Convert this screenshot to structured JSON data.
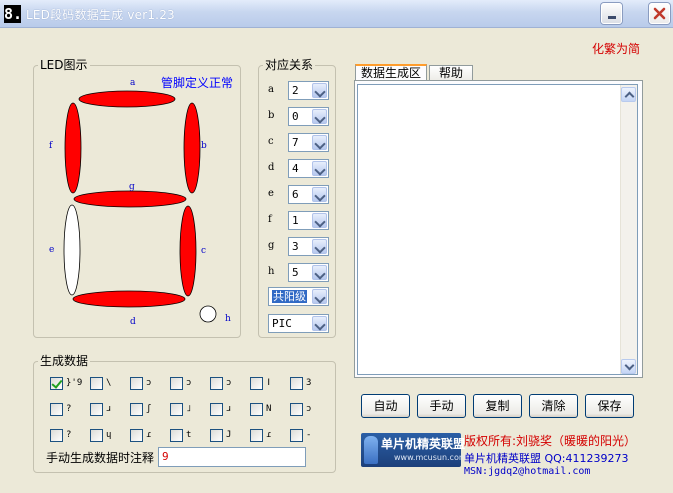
{
  "window": {
    "icon_glyph": "8.",
    "title": "LED段码数据生成 ver1.23",
    "minimize_icon": "minimize-icon",
    "close_icon": "close-icon"
  },
  "top_link": "化繁为简",
  "led_group": {
    "title": "LED图示",
    "pin_definition": "管脚定义正常",
    "segment_letters": [
      "a",
      "b",
      "c",
      "d",
      "e",
      "f",
      "g",
      "h"
    ],
    "segments_lit": [
      "a",
      "b",
      "c",
      "d",
      "f",
      "g"
    ],
    "segments_unlit": [
      "e",
      "h"
    ],
    "lit_color": "#ff0000",
    "unlit_color": "#ffffff"
  },
  "mapping_group": {
    "title": "对应关系",
    "rows": [
      {
        "segment": "a",
        "value": "2"
      },
      {
        "segment": "b",
        "value": "0"
      },
      {
        "segment": "c",
        "value": "7"
      },
      {
        "segment": "d",
        "value": "4"
      },
      {
        "segment": "e",
        "value": "6"
      },
      {
        "segment": "f",
        "value": "1"
      },
      {
        "segment": "g",
        "value": "3"
      },
      {
        "segment": "h",
        "value": "5"
      }
    ],
    "type_select": "共阳级",
    "platform_select": "PIC"
  },
  "tabs": [
    {
      "label": "数据生成区",
      "active": true
    },
    {
      "label": "帮助",
      "active": false
    }
  ],
  "output_text": "",
  "generate_group": {
    "title": "生成数据",
    "checkboxes": [
      {
        "label": "}'9",
        "checked": true
      },
      {
        "label": "\\",
        "checked": false
      },
      {
        "label": "ɔ",
        "checked": false
      },
      {
        "label": "ɔ",
        "checked": false
      },
      {
        "label": "ɔ",
        "checked": false
      },
      {
        "label": "ǀ",
        "checked": false
      },
      {
        "label": "3",
        "checked": false
      },
      {
        "label": "?",
        "checked": false
      },
      {
        "label": "ɹ",
        "checked": false
      },
      {
        "label": "ʃ",
        "checked": false
      },
      {
        "label": "˩",
        "checked": false
      },
      {
        "label": "ɹ",
        "checked": false
      },
      {
        "label": "N",
        "checked": false
      },
      {
        "label": "ɔ",
        "checked": false
      },
      {
        "label": "?",
        "checked": false
      },
      {
        "label": "ɥ",
        "checked": false
      },
      {
        "label": "ɾ",
        "checked": false
      },
      {
        "label": "t",
        "checked": false
      },
      {
        "label": "J",
        "checked": false
      },
      {
        "label": "ɾ",
        "checked": false
      },
      {
        "label": "-",
        "checked": false
      }
    ],
    "comment_label": "手动生成数据时注释",
    "comment_value": "9"
  },
  "buttons": {
    "auto": "自动",
    "manual": "手动",
    "copy": "复制",
    "clear": "清除",
    "save": "保存"
  },
  "footer": {
    "logo_text": "单片机精英联盟",
    "logo_url": "www.mcusun.com",
    "copyright": "版权所有:刘骁奖（暖暖的阳光）",
    "qq": "单片机精英联盟 QQ:411239273",
    "msn": "MSN:jgdq2@hotmail.com"
  },
  "colors": {
    "accent_red": "#d40000",
    "link_blue": "#0000ff",
    "window_bg": "#ece9d8"
  }
}
